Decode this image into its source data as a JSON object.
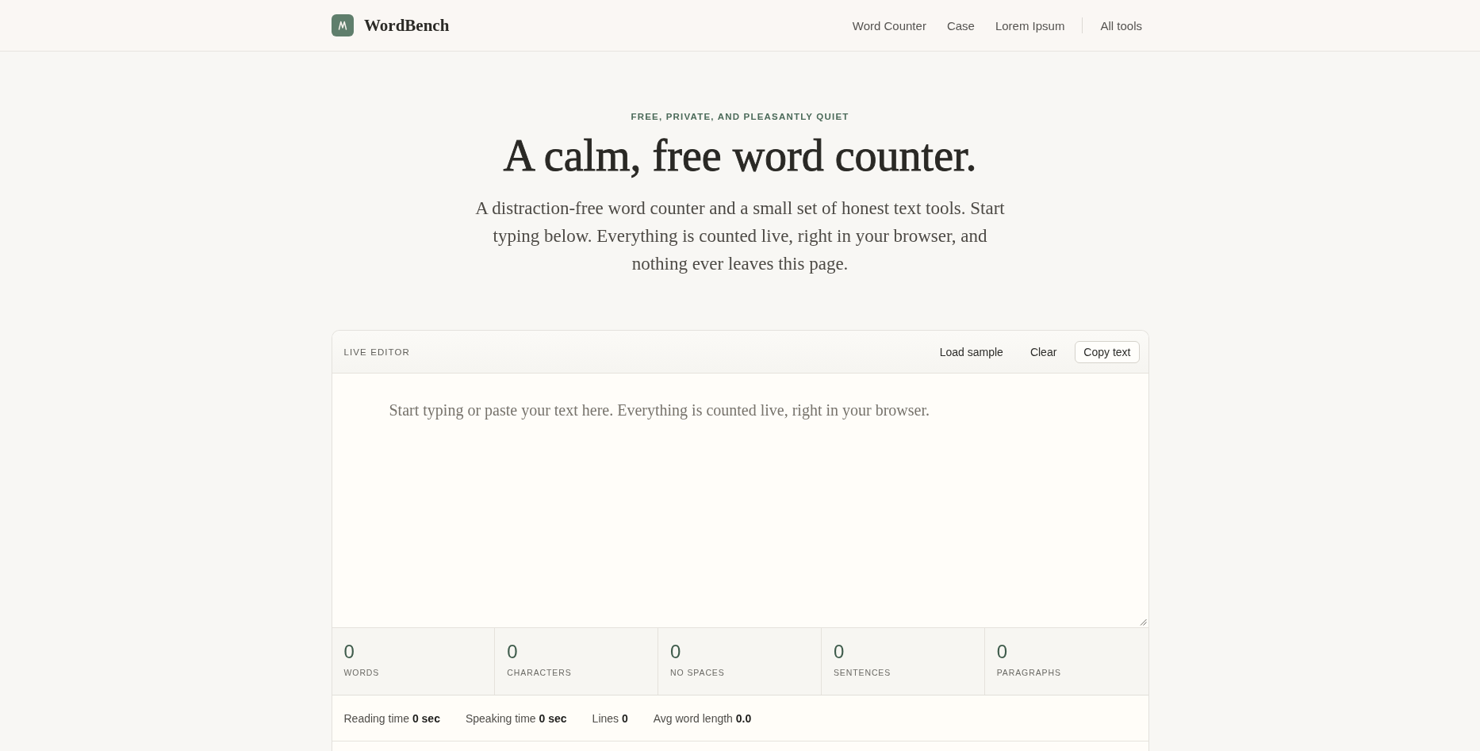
{
  "header": {
    "brand": "WordBench",
    "nav": [
      {
        "label": "Word Counter"
      },
      {
        "label": "Case"
      },
      {
        "label": "Lorem Ipsum"
      }
    ],
    "all_tools": "All tools"
  },
  "hero": {
    "eyebrow": "FREE, PRIVATE, AND PLEASANTLY QUIET",
    "title": "A calm, free word counter.",
    "intro": "A distraction-free word counter and a small set of honest text tools. Start typing below. Everything is counted live, right in your browser, and nothing ever leaves this page."
  },
  "editor": {
    "label": "LIVE EDITOR",
    "actions": [
      {
        "label": "Load sample",
        "kind": "plain"
      },
      {
        "label": "Clear",
        "kind": "plain"
      },
      {
        "label": "Copy text",
        "kind": "outlined"
      }
    ],
    "placeholder": "Start typing or paste your text here. Everything is counted live, right in your browser.",
    "stats": [
      {
        "value": "0",
        "label": "WORDS"
      },
      {
        "value": "0",
        "label": "CHARACTERS"
      },
      {
        "value": "0",
        "label": "NO SPACES"
      },
      {
        "value": "0",
        "label": "SENTENCES"
      },
      {
        "value": "0",
        "label": "PARAGRAPHS"
      }
    ],
    "details": [
      "Reading time **0 sec**",
      "Speaking time **0 sec**",
      "Lines **0**",
      "Avg word length **0.0**"
    ]
  }
}
